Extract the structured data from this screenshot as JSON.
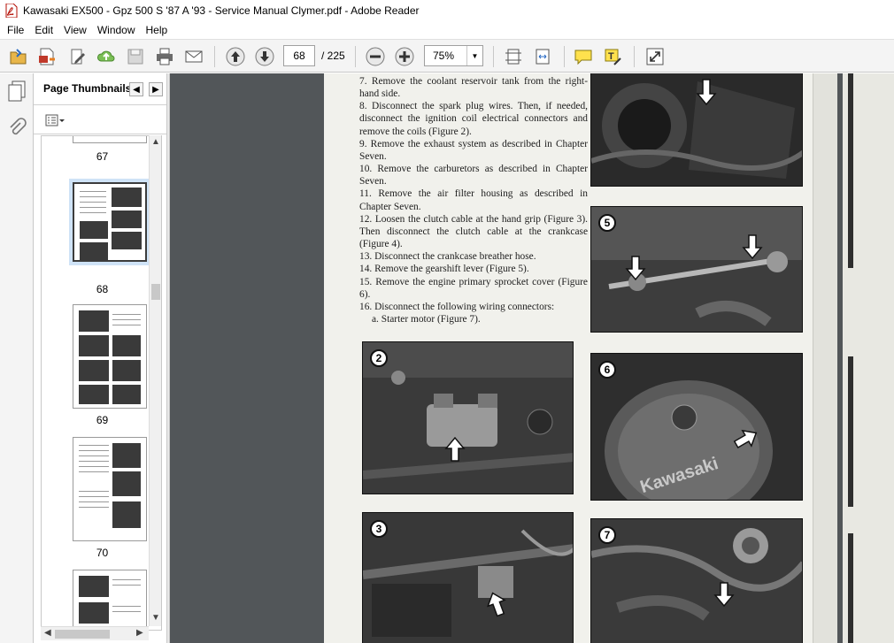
{
  "window": {
    "title": "Kawasaki EX500 - Gpz 500 S '87 A '93 - Service Manual Clymer.pdf - Adobe Reader"
  },
  "menu": [
    "File",
    "Edit",
    "View",
    "Window",
    "Help"
  ],
  "toolbar": {
    "page_current": "68",
    "page_total": "/ 225",
    "zoom": "75%",
    "icons": [
      "open-icon",
      "create-pdf-icon",
      "edit-icon",
      "upload-cloud-icon",
      "save-icon",
      "print-icon",
      "email-icon",
      "page-up-icon",
      "page-down-icon",
      "zoom-out-icon",
      "zoom-in-icon",
      "fit-page-icon",
      "fit-width-icon",
      "comment-icon",
      "highlight-icon",
      "expand-icon"
    ]
  },
  "thumbnails": {
    "panel_title": "Page Thumbnails",
    "pages": [
      {
        "label": "67"
      },
      {
        "label": "68",
        "selected": true
      },
      {
        "label": "69"
      },
      {
        "label": "70"
      }
    ]
  },
  "document": {
    "steps": [
      "7. Remove the coolant reservoir tank from the right-hand side.",
      "8. Disconnect the spark plug wires. Then, if needed, disconnect the ignition coil electrical connectors and remove the coils (Figure 2).",
      "9. Remove the exhaust system as described in Chapter Seven.",
      "10. Remove the carburetors as described in Chapter Seven.",
      "11. Remove the air filter housing as described in Chapter Seven.",
      "12. Loosen the clutch cable at the hand grip (Figure 3). Then disconnect the clutch cable at the crankcase (Figure 4).",
      "13. Disconnect the crankcase breather hose.",
      "14. Remove the gearshift lever (Figure 5).",
      "15. Remove the engine primary sprocket cover (Figure 6).",
      "16. Disconnect the following wiring connectors:",
      "a. Starter motor (Figure 7)."
    ],
    "figures": [
      {
        "number": "2"
      },
      {
        "number": "3"
      },
      {
        "number": "5"
      },
      {
        "number": "6"
      },
      {
        "number": "7"
      }
    ],
    "logo_text": "Kawasaki"
  }
}
